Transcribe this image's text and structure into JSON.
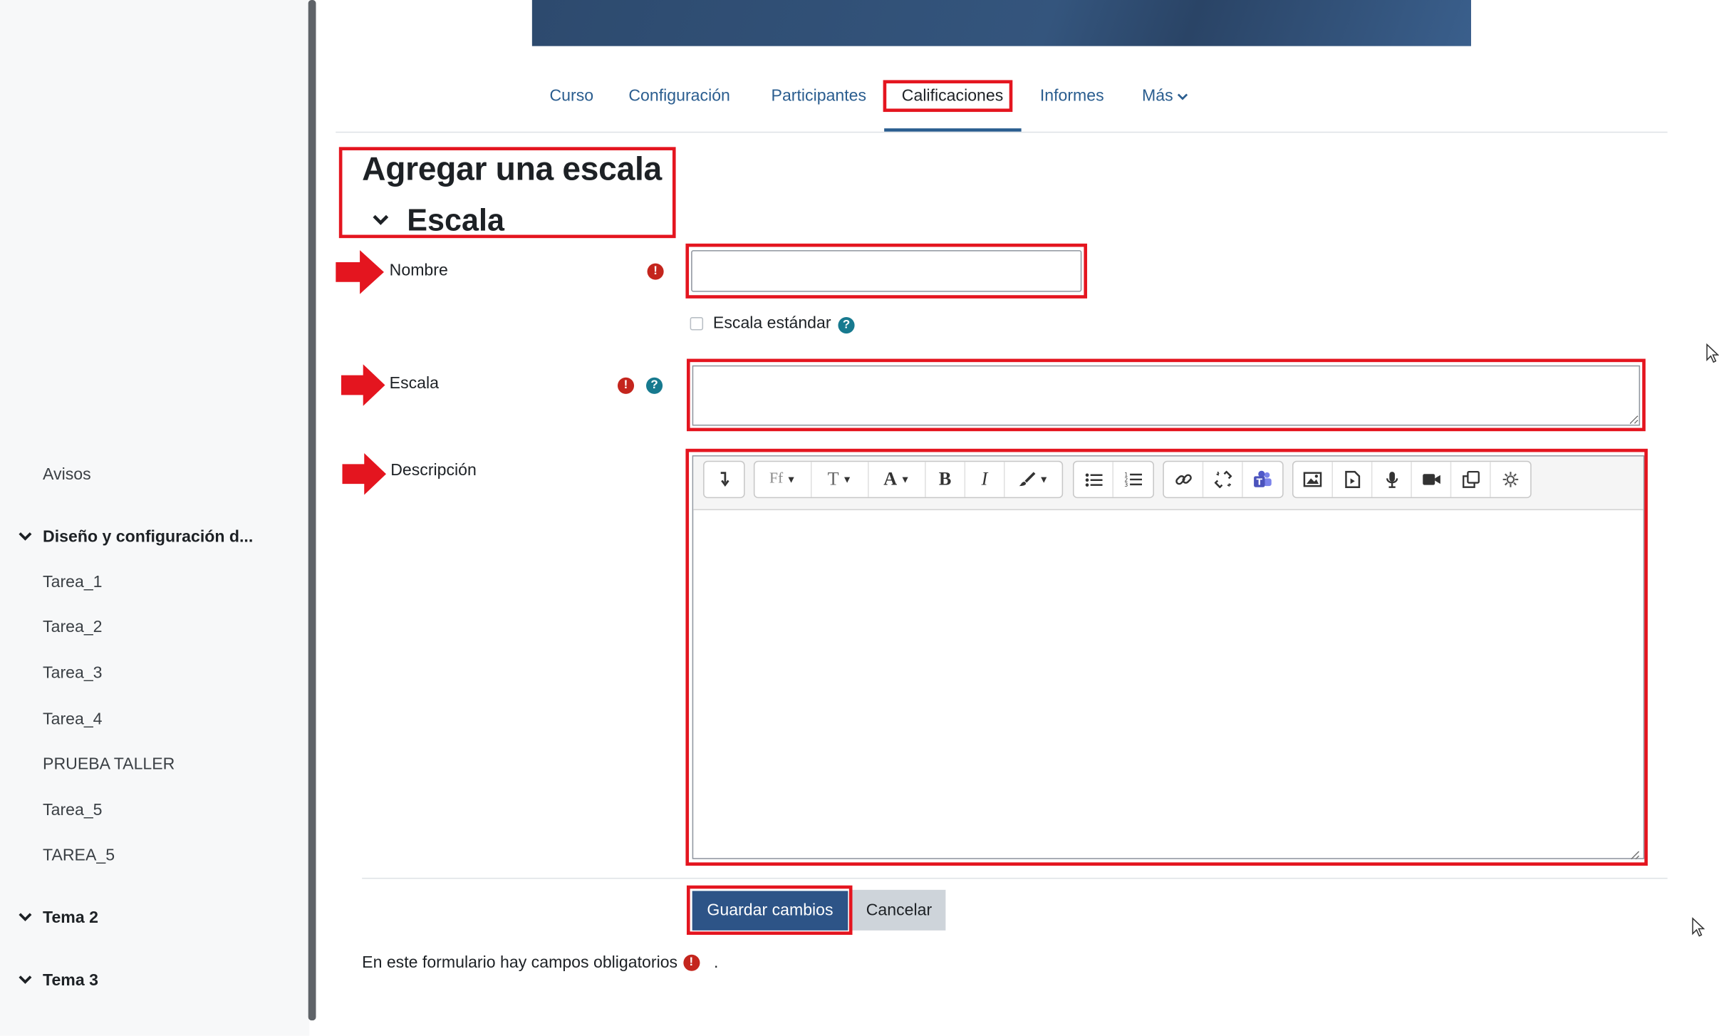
{
  "sidebar": {
    "items": [
      {
        "label": "Avisos"
      },
      {
        "label": "Diseño y configuración d...",
        "section": true
      },
      {
        "label": "Tarea_1"
      },
      {
        "label": "Tarea_2"
      },
      {
        "label": "Tarea_3"
      },
      {
        "label": "Tarea_4"
      },
      {
        "label": "PRUEBA TALLER"
      },
      {
        "label": "Tarea_5"
      },
      {
        "label": "TAREA_5"
      },
      {
        "label": "Tema 2",
        "section": true
      },
      {
        "label": "Tema 3",
        "section": true
      }
    ]
  },
  "tabs": [
    {
      "label": "Curso"
    },
    {
      "label": "Configuración"
    },
    {
      "label": "Participantes"
    },
    {
      "label": "Calificaciones",
      "active": true
    },
    {
      "label": "Informes"
    },
    {
      "label": "Más"
    }
  ],
  "page": {
    "title": "Agregar una escala",
    "section_title": "Escala"
  },
  "form": {
    "name_label": "Nombre",
    "name_value": "",
    "standard_scale_label": "Escala estándar",
    "standard_scale_checked": false,
    "scale_label": "Escala",
    "scale_value": "",
    "description_label": "Descripción",
    "description_value": "",
    "required_icon": "exclamation-circle-icon",
    "help_icon": "question-circle-icon"
  },
  "editor_toolbar": [
    [
      "arrow-down-icon"
    ],
    [
      "font-family-icon",
      "font-size-icon",
      "font-color-icon",
      "bold-icon",
      "italic-icon",
      "paint-brush-icon"
    ],
    [
      "bullet-list-icon",
      "numbered-list-icon"
    ],
    [
      "link-icon",
      "unlink-icon",
      "teams-icon"
    ],
    [
      "image-icon",
      "media-icon",
      "microphone-icon",
      "video-icon",
      "copy-icon",
      "accessibility-icon"
    ]
  ],
  "buttons": {
    "save_label": "Guardar cambios",
    "cancel_label": "Cancelar"
  },
  "footer": {
    "required_note": "En este formulario hay campos obligatorios",
    "required_note_end": "."
  },
  "colors": {
    "accent": "#2a5d8f",
    "primary_button": "#2d5487",
    "annotation_red": "#e4151f",
    "required": "#c4251d"
  }
}
